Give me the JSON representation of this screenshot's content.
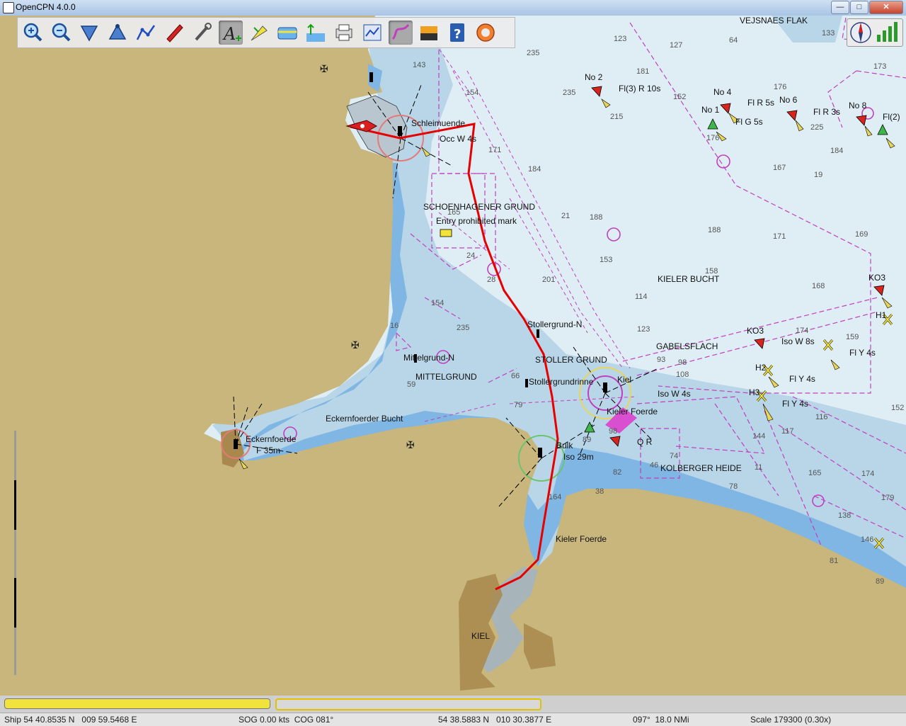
{
  "window": {
    "title": "OpenCPN 4.0.0",
    "minimize_glyph": "—",
    "maximize_glyph": "□",
    "close_glyph": "✕"
  },
  "toolbar": {
    "buttons": [
      {
        "name": "zoom-in-icon"
      },
      {
        "name": "zoom-out-icon"
      },
      {
        "name": "scale-down-icon"
      },
      {
        "name": "scale-up-icon"
      },
      {
        "name": "route-icon"
      },
      {
        "name": "auto-follow-icon"
      },
      {
        "name": "settings-icon"
      },
      {
        "name": "text-icon"
      },
      {
        "name": "current-tide-icon"
      },
      {
        "name": "ais-icon"
      },
      {
        "name": "tide-icon"
      },
      {
        "name": "print-icon"
      },
      {
        "name": "route-manager-icon"
      },
      {
        "name": "track-icon"
      },
      {
        "name": "color-scheme-icon"
      },
      {
        "name": "help-icon"
      },
      {
        "name": "mob-icon"
      }
    ]
  },
  "map_labels": {
    "vejsnaes_flak": "VEJSNAES FLAK",
    "schleimuende": "Schleimuende",
    "occ_w_4s": "Occ W 4s",
    "schoenhagener_grund": "SCHOENHAGENER GRUND",
    "entry_prohibited": "Entry prohibited mark",
    "no2": "No 2",
    "fl3_r_10s": "Fl(3) R 10s",
    "no4": "No 4",
    "fl_r_5s": "Fl R 5s",
    "no6": "No 6",
    "fl_r_3s": "Fl R 3s",
    "no8": "No 8",
    "fl2": "Fl(2)",
    "no1": "No 1",
    "fl_g_5s": "Fl G 5s",
    "kieler_bucht": "KIELER BUCHT",
    "ko3a": "KO3",
    "ko3b": "KO3",
    "stollergrund_n": "Stollergrund-N",
    "gabelsflach": "GABELSFLACH",
    "iso_w_8s": "Iso W 8s",
    "fl_y_4s_a": "Fl Y 4s",
    "fl_y_4s_b": "Fl Y 4s",
    "fl_y_4s_c": "Fl Y 4s",
    "stoller_grund": "STOLLER GRUND",
    "stollergrundrinne": "Stollergrundrinne",
    "kiel": "Kiel",
    "iso_w_4s": "Iso W 4s",
    "kieler_foerde_light": "Kieler Foerde",
    "q_r": "Q R",
    "kolberger_heide": "KOLBERGER HEIDE",
    "mittelgrund_n": "Mittelgrund-N",
    "mittelgrund": "MITTELGRUND",
    "eckernfoerder_bucht": "Eckernfoerder Bucht",
    "eckernfoerde": "Eckernfoerde",
    "f_35m": "F 35m",
    "bulk": "Bulk",
    "iso_29m": "Iso 29m",
    "kieler_foerde": "Kieler Foerde",
    "kiel_city": "KIEL",
    "h1": "H1",
    "h2": "H2",
    "h3": "H3"
  },
  "depths": [
    {
      "v": "123"
    },
    {
      "v": "127"
    },
    {
      "v": "133"
    },
    {
      "v": "64"
    },
    {
      "v": "235"
    },
    {
      "v": "143"
    },
    {
      "v": "181"
    },
    {
      "v": "152"
    },
    {
      "v": "176"
    },
    {
      "v": "173"
    },
    {
      "v": "154"
    },
    {
      "v": "235"
    },
    {
      "v": "215"
    },
    {
      "v": "176"
    },
    {
      "v": "225"
    },
    {
      "v": "184"
    },
    {
      "v": "167"
    },
    {
      "v": "19"
    },
    {
      "v": "171"
    },
    {
      "v": "184"
    },
    {
      "v": "21"
    },
    {
      "v": "188"
    },
    {
      "v": "165"
    },
    {
      "v": "188"
    },
    {
      "v": "171"
    },
    {
      "v": "169"
    },
    {
      "v": "24"
    },
    {
      "v": "153"
    },
    {
      "v": "158"
    },
    {
      "v": "201"
    },
    {
      "v": "114"
    },
    {
      "v": "168"
    },
    {
      "v": "154"
    },
    {
      "v": "235"
    },
    {
      "v": "123"
    },
    {
      "v": "174"
    },
    {
      "v": "159"
    },
    {
      "v": "16"
    },
    {
      "v": "93"
    },
    {
      "v": "98"
    },
    {
      "v": "108"
    },
    {
      "v": "66"
    },
    {
      "v": "79"
    },
    {
      "v": "59"
    },
    {
      "v": "116"
    },
    {
      "v": "152"
    },
    {
      "v": "144"
    },
    {
      "v": "117"
    },
    {
      "v": "11"
    },
    {
      "v": "165"
    },
    {
      "v": "174"
    },
    {
      "v": "82"
    },
    {
      "v": "78"
    },
    {
      "v": "138"
    },
    {
      "v": "179"
    },
    {
      "v": "164"
    },
    {
      "v": "38"
    },
    {
      "v": "146"
    },
    {
      "v": "81"
    },
    {
      "v": "89"
    },
    {
      "v": "74"
    },
    {
      "v": "46"
    },
    {
      "v": "89"
    },
    {
      "v": "98"
    },
    {
      "v": "28"
    }
  ],
  "compass": {
    "name": "compass-icon"
  },
  "status": {
    "ship": "Ship 54 40.8535 N   009 59.5468 E",
    "sog_cog": "SOG 0.00 kts  COG 081°",
    "cursor": "54 38.5883 N   010 30.3877 E",
    "bearing_dist": "097°  18.0 NMi",
    "scale": "Scale 179300 (0.30x)"
  },
  "colors": {
    "land": "#c8b67d",
    "deep_water": "#dfeef5",
    "mid_water": "#b8d6e8",
    "shallow_water": "#7fb6e3",
    "route": "#e60000",
    "magenta": "#c040c0"
  }
}
